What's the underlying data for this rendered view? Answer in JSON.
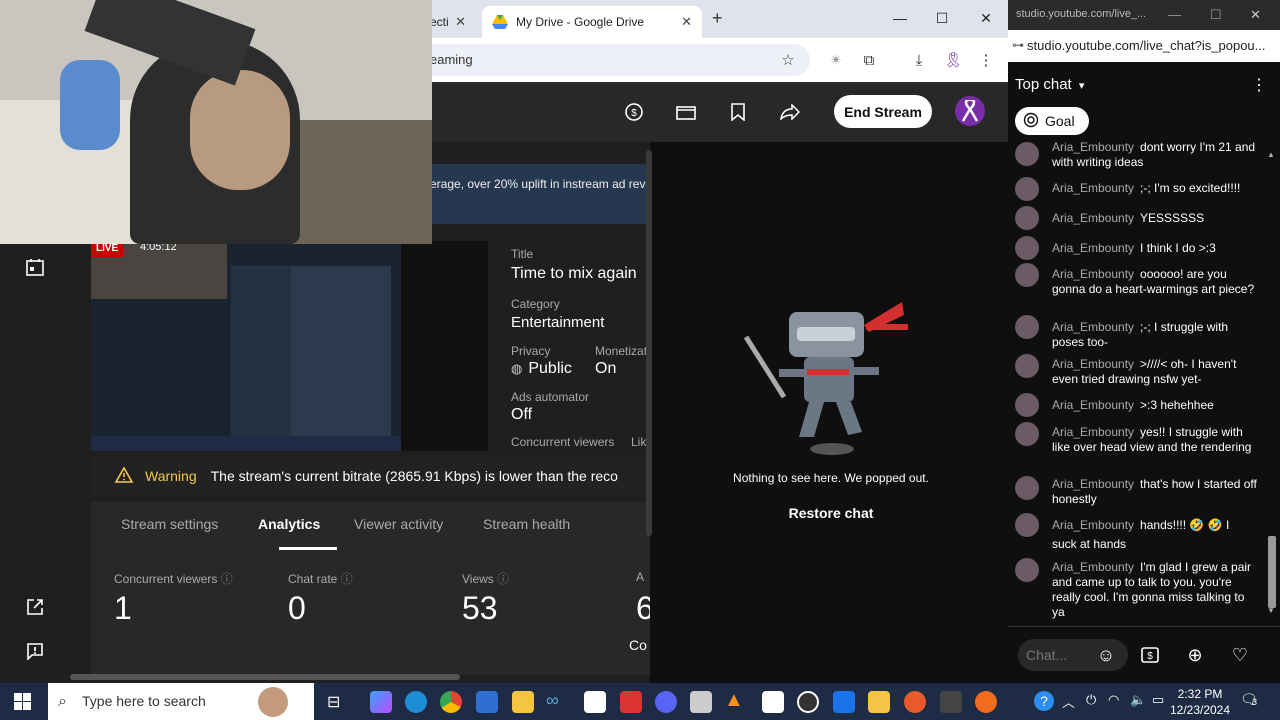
{
  "browser": {
    "tabs": [
      {
        "label": "ecti"
      },
      {
        "label": "My Drive - Google Drive"
      }
    ],
    "new_tab": "+",
    "url_fragment": "eaming",
    "window_controls": {
      "minimize": "—",
      "maximize": "☐",
      "close": "✕"
    }
  },
  "studio": {
    "end_stream_label": "End Stream",
    "banner_text": "erage, over 20% uplift in instream ad reve",
    "live_badge": "LIVE",
    "live_timer": "4:05:12",
    "meta": {
      "title_label": "Title",
      "title_value": "Time to mix again",
      "category_label": "Category",
      "category_value": "Entertainment",
      "privacy_label": "Privacy",
      "privacy_value": "Public",
      "monetization_label": "Monetizat",
      "monetization_value": "On",
      "ads_label": "Ads automator",
      "ads_value": "Off",
      "concurrent_label": "Concurrent viewers",
      "likes_label": "Lik"
    },
    "warning_label": "Warning",
    "warning_text": "The stream's current bitrate (2865.91 Kbps) is lower than the reco",
    "tabs": [
      {
        "label": "Stream settings"
      },
      {
        "label": "Analytics"
      },
      {
        "label": "Viewer activity"
      },
      {
        "label": "Stream health"
      }
    ],
    "stats": [
      {
        "label": "Concurrent viewers",
        "value": "1"
      },
      {
        "label": "Chat rate",
        "value": "0"
      },
      {
        "label": "Views",
        "value": "53"
      },
      {
        "label": "A",
        "value": "6"
      }
    ],
    "stats_extra": "Co",
    "popped_message": "Nothing to see here. We popped out.",
    "restore_chat": "Restore chat"
  },
  "chat_window": {
    "title": "studio.youtube.com/live_...",
    "url": "studio.youtube.com/live_chat?is_popou...",
    "header_label": "Top chat",
    "goal_label": "Goal",
    "input_placeholder": "Chat...",
    "messages": [
      {
        "author": "Aria_Embounty",
        "text": "dont worry I'm 21 and with writing ideas"
      },
      {
        "author": "Aria_Embounty",
        "text": ";-; I'm so excited!!!!"
      },
      {
        "author": "Aria_Embounty",
        "text": "YESSSSSS"
      },
      {
        "author": "Aria_Embounty",
        "text": "I think I do >:3"
      },
      {
        "author": "Aria_Embounty",
        "text": "oooooo! are you gonna do a heart-warmings art piece?"
      },
      {
        "author": "Aria_Embounty",
        "text": ";-; I struggle with poses too-"
      },
      {
        "author": "Aria_Embounty",
        "text": ">////< oh- I haven't even tried drawing nsfw yet-"
      },
      {
        "author": "Aria_Embounty",
        "text": ">:3 hehehhee"
      },
      {
        "author": "Aria_Embounty",
        "text": "yes!! I struggle with like over head view and the rendering"
      },
      {
        "author": "Aria_Embounty",
        "text": "that's how I started off honestly"
      },
      {
        "author": "Aria_Embounty",
        "text": "hands!!!! 🤣 🤣 I suck at hands"
      },
      {
        "author": "Aria_Embounty",
        "text": "I'm glad I grew a pair and came up to talk to you. you're really cool. I'm gonna miss talking to ya"
      }
    ]
  },
  "taskbar": {
    "search_placeholder": "Type here to search",
    "time": "2:32 PM",
    "date": "12/23/2024",
    "notification_count": "3"
  },
  "colors": {
    "accent_red": "#cc0000",
    "warning_yellow": "#f2c94c",
    "banner_blue": "#263850",
    "avatar_purple": "#7a2da8"
  }
}
